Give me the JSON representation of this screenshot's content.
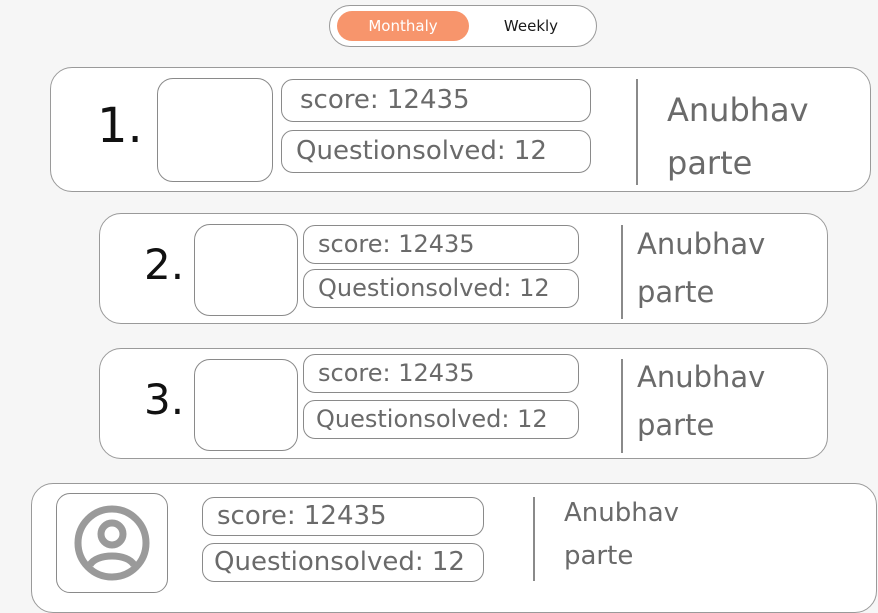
{
  "tabs": {
    "monthly_label": "Monthaly",
    "weekly_label": "Weekly",
    "active": "Monthaly",
    "active_color": "#f7956c"
  },
  "leaderboard": [
    {
      "rank": "1.",
      "score": "score: 12435",
      "questions": "Questionsolved: 12",
      "first_name": "Anubhav",
      "last_name": "parte"
    },
    {
      "rank": "2.",
      "score": "score: 12435",
      "questions": "Questionsolved: 12",
      "first_name": "Anubhav",
      "last_name": "parte"
    },
    {
      "rank": "3.",
      "score": "score: 12435",
      "questions": "Questionsolved: 12",
      "first_name": "Anubhav",
      "last_name": "parte"
    }
  ],
  "current_user": {
    "avatar_icon": "user-circle-icon",
    "score": "score: 12435",
    "questions": "Questionsolved: 12",
    "first_name": "Anubhav",
    "last_name": "parte"
  }
}
